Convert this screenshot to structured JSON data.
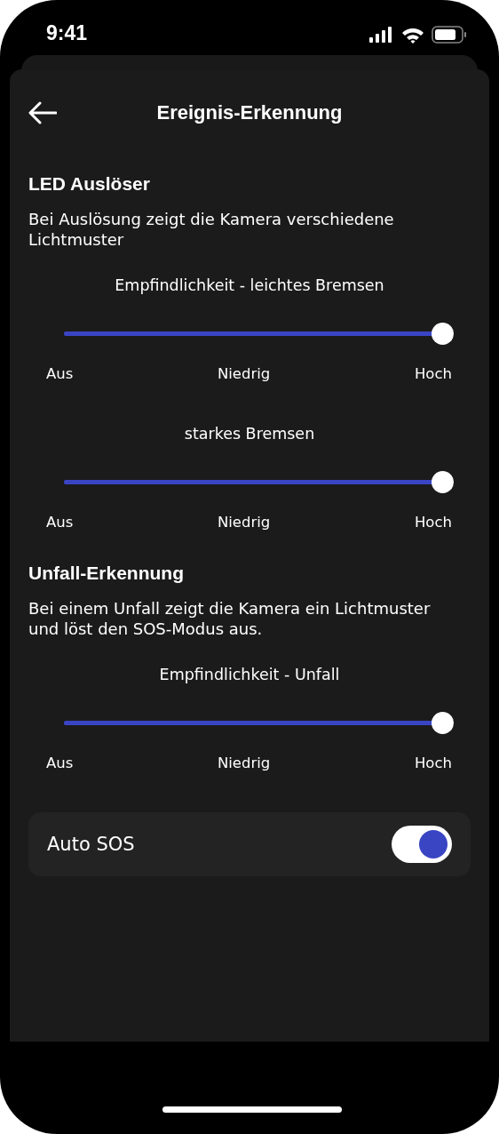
{
  "status_bar": {
    "time": "9:41"
  },
  "header": {
    "title": "Ereignis-Erkennung"
  },
  "sections": [
    {
      "title": "LED Auslöser",
      "description": "Bei Auslösung zeigt die Kamera verschiedene Lichtmuster",
      "sliders": [
        {
          "label": "Empfindlichkeit - leichtes Bremsen",
          "level": 1,
          "ticks": [
            "Aus",
            "Niedrig",
            "Hoch"
          ]
        },
        {
          "label": "starkes Bremsen",
          "level": 1,
          "ticks": [
            "Aus",
            "Niedrig",
            "Hoch"
          ]
        }
      ]
    },
    {
      "title": "Unfall-Erkennung",
      "description": "Bei einem Unfall zeigt die Kamera ein Lichtmuster und löst den SOS-Modus aus.",
      "sliders": [
        {
          "label": "Empfindlichkeit - Unfall",
          "level": 1,
          "ticks": [
            "Aus",
            "Niedrig",
            "Hoch"
          ]
        }
      ]
    }
  ],
  "toggle": {
    "label": "Auto SOS",
    "on": true
  }
}
